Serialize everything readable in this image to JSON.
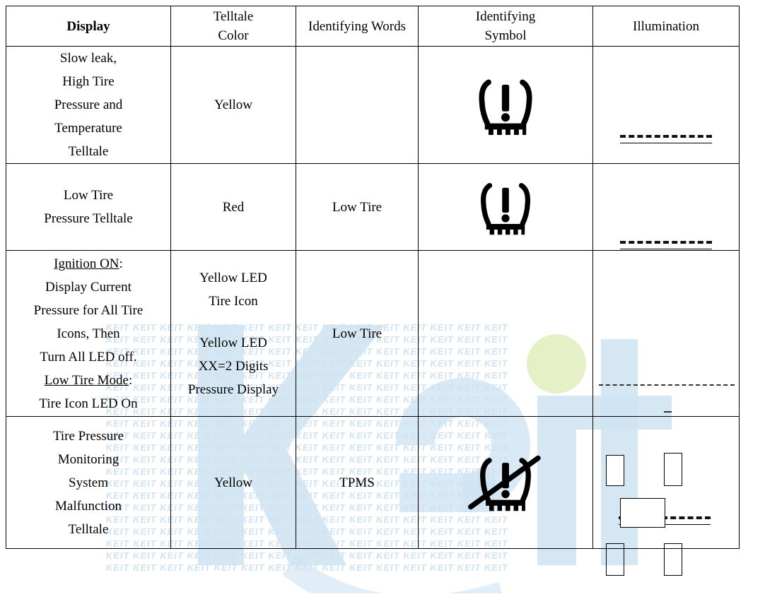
{
  "table": {
    "headers": [
      {
        "label": "Display",
        "bold": true
      },
      {
        "line1": "Telltale",
        "line2": "Color"
      },
      {
        "label": "Identifying Words"
      },
      {
        "line1": "Identifying",
        "line2": "Symbol"
      },
      {
        "label": "Illumination"
      }
    ],
    "header_labels": {
      "display": "Display",
      "telltale_color_1": "Telltale",
      "telltale_color_2": "Color",
      "identifying_words": "Identifying Words",
      "identifying_symbol_1": "Identifying",
      "identifying_symbol_2": "Symbol",
      "illumination": "Illumination"
    },
    "rows": [
      {
        "id": "row-slow-leak",
        "display_lines": [
          "Slow leak,",
          "High Tire",
          "Pressure and",
          "Temperature",
          "Telltale"
        ],
        "telltale_color": "Yellow",
        "identifying_words": "",
        "identifying_symbol": "tire-pressure-warning-icon",
        "illumination": "dashed-line-with-underline"
      },
      {
        "id": "row-low-tire",
        "display_lines": [
          "Low Tire",
          "Pressure Telltale"
        ],
        "telltale_color": "Red",
        "identifying_words": "Low Tire",
        "identifying_symbol": "tire-pressure-warning-icon",
        "illumination": "dashed-line-with-underline"
      },
      {
        "id": "row-ignition-on",
        "display_lines": [
          "Ignition ON:",
          "Display Current",
          "Pressure for All Tire",
          "Icons, Then",
          "Turn All LED off.",
          "Low Tire Mode:",
          "Tire Icon LED On"
        ],
        "display_underlined": [
          "Ignition ON",
          "Low Tire Mode"
        ],
        "telltale_color_block_1": [
          "Yellow LED",
          "Tire Icon"
        ],
        "telltale_color_block_2": [
          "Yellow LED",
          "XX=2 Digits",
          "Pressure Display"
        ],
        "identifying_words": "Low Tire",
        "identifying_symbol": "",
        "illumination": "wide-dashed-line-with-short-dash"
      },
      {
        "id": "row-tpms-malfunction",
        "display_lines": [
          "Tire Pressure",
          "Monitoring",
          "System",
          "Malfunction",
          "Telltale"
        ],
        "telltale_color": "Yellow",
        "identifying_words": "TPMS",
        "identifying_symbol": "tpms-malfunction-icon",
        "illumination": "dashed-line-with-boxes-schematic"
      }
    ]
  },
  "watermark": {
    "text": "KEIT",
    "logo_text": "Keit",
    "tile_color": "#cfe3f2",
    "logo_color": "#cfe3f2",
    "dot_color": "#e3eec0"
  },
  "colors": {
    "border": "#000000",
    "text": "#000000",
    "icon": "#000000",
    "watermark_blue": "#cfe3f2",
    "watermark_green": "#e3eec0"
  }
}
